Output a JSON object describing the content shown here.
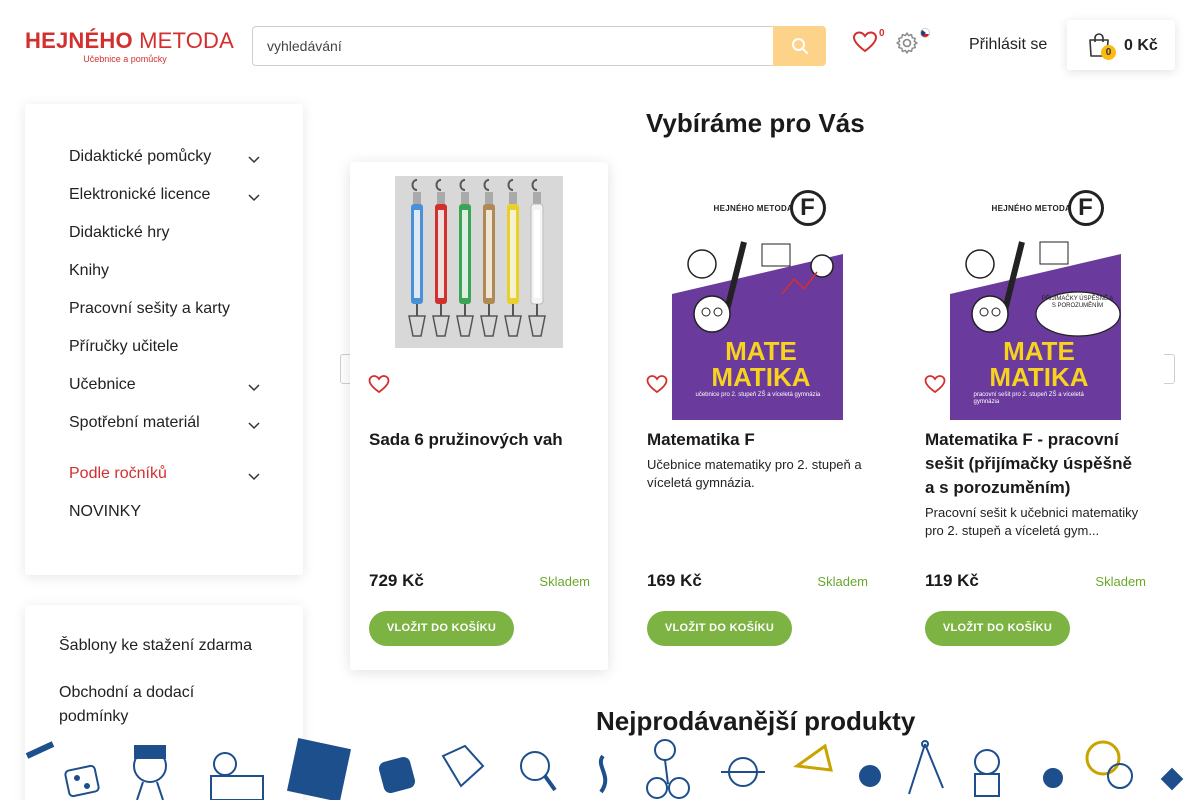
{
  "header": {
    "logo_main": "HEJNÉHO",
    "logo_light": "METODA",
    "logo_tagline": "Učebnice a pomůcky",
    "search_placeholder": "vyhledávání",
    "wishlist_count": "0",
    "login_label": "Přihlásit se",
    "cart_count": "0",
    "cart_total": "0 Kč"
  },
  "sidebar": {
    "categories": [
      {
        "label": "Didaktické pomůcky",
        "has_submenu": true,
        "active": false
      },
      {
        "label": "Elektronické licence",
        "has_submenu": true,
        "active": false
      },
      {
        "label": "Didaktické hry",
        "has_submenu": false,
        "active": false
      },
      {
        "label": "Knihy",
        "has_submenu": false,
        "active": false
      },
      {
        "label": "Pracovní sešity a karty",
        "has_submenu": false,
        "active": false
      },
      {
        "label": "Příručky učitele",
        "has_submenu": false,
        "active": false
      },
      {
        "label": "Učebnice",
        "has_submenu": true,
        "active": false
      },
      {
        "label": "Spotřební materiál",
        "has_submenu": true,
        "active": false
      },
      {
        "label": "Podle ročníků",
        "has_submenu": true,
        "active": true
      },
      {
        "label": "NOVINKY",
        "has_submenu": false,
        "active": false
      }
    ],
    "links": [
      {
        "label": "Šablony ke stažení zdarma"
      },
      {
        "label": "Obchodní a dodací podmínky"
      }
    ]
  },
  "main": {
    "recommended_title": "Vybíráme pro Vás",
    "bestsellers_title": "Nejprodávanější produkty",
    "products": [
      {
        "name": "Sada 6 pružinových vah",
        "description": "",
        "price": "729 Kč",
        "stock": "Skladem",
        "buy_label": "VLOŽIT DO KOŠÍKU"
      },
      {
        "name": "Matematika F",
        "description": "Učebnice matematiky pro 2. stupeň a víceletá gymnázia.",
        "price": "169 Kč",
        "stock": "Skladem",
        "buy_label": "VLOŽIT DO KOŠÍKU",
        "cover": {
          "brand": "HEJNÉHO METODA",
          "letter": "F",
          "title": "MATE MATIKA",
          "subtitle": "učebnice pro 2. stupeň ZŠ a víceletá gymnázia"
        }
      },
      {
        "name": "Matematika F - pracovní sešit (přijímačky úspěšně a s porozuměním)",
        "description": "Pracovní sešit k učebnici matematiky pro 2. stupeň a víceletá gym...",
        "price": "119 Kč",
        "stock": "Skladem",
        "buy_label": "VLOŽIT DO KOŠÍKU",
        "cover": {
          "brand": "HEJNÉHO METODA",
          "letter": "F",
          "title": "MATE MATIKA",
          "subtitle": "pracovní sešit pro 2. stupeň ZŠ a víceletá gymnázia",
          "bubble": "PŘIJÍMAČKY ÚSPĚŠNĚ A S POROZUMĚNÍM"
        }
      }
    ]
  },
  "colors": {
    "brand_red": "#d32f2f",
    "search_button": "#fdd38a",
    "buy_green": "#7cb342",
    "stock_green": "#6aa82b",
    "book_purple": "#6a3a9c",
    "footer_icons": "#1d4f8c"
  },
  "icons": [
    "search-icon",
    "heart-icon",
    "gear-icon",
    "cz-flag-icon",
    "shopping-bag-icon",
    "chevron-down-icon",
    "chevron-left-icon",
    "chevron-right-icon"
  ]
}
